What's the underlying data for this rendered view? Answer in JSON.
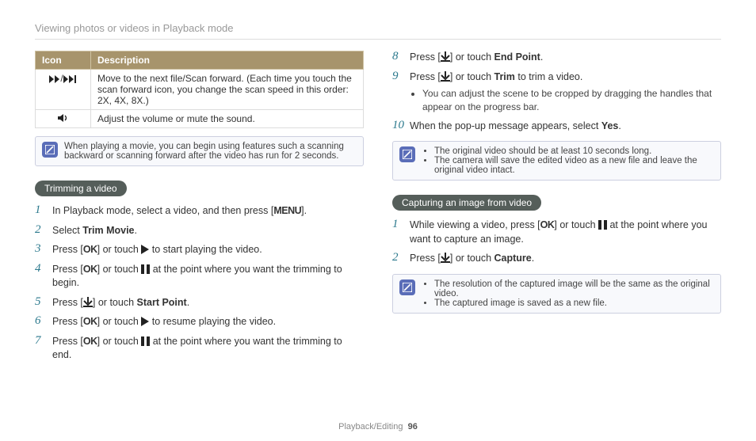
{
  "breadcrumb": "Viewing photos or videos in Playback mode",
  "table": {
    "header_icon": "Icon",
    "header_desc": "Description",
    "row1_desc": "Move to the next file/Scan forward. (Each time you touch the scan forward icon, you change the scan speed in this order: 2X, 4X, 8X.)",
    "row2_desc": "Adjust the volume or mute the sound."
  },
  "note_play": "When playing a movie, you can begin using features such a scanning backward or scanning forward after the video has run for 2 seconds.",
  "section_trim": "Trimming a video",
  "trim": {
    "s1a": "In Playback mode, select a video, and then press [",
    "s1_menu": "MENU",
    "s1b": "].",
    "s2a": "Select ",
    "s2_bold": "Trim Movie",
    "s2b": ".",
    "s3a": "Press [",
    "s3_ok": "OK",
    "s3b": "] or touch ",
    "s3c": " to start playing the video.",
    "s4a": "Press [",
    "s4_ok": "OK",
    "s4b": "] or touch ",
    "s4c": " at the point where you want the trimming to begin.",
    "s5a": "Press [",
    "s5b": "] or touch ",
    "s5_bold": "Start Point",
    "s5c": ".",
    "s6a": "Press [",
    "s6_ok": "OK",
    "s6b": "] or touch ",
    "s6c": " to resume playing the video.",
    "s7a": "Press [",
    "s7_ok": "OK",
    "s7b": "] or touch ",
    "s7c": " at the point where you want the trimming to end.",
    "s8a": "Press [",
    "s8b": "] or touch ",
    "s8_bold": "End Point",
    "s8c": ".",
    "s9a": "Press [",
    "s9b": "] or touch ",
    "s9_bold": "Trim",
    "s9c": " to trim a video.",
    "s9_sub": "You can adjust the scene to be cropped by dragging the handles that appear on the progress bar.",
    "s10a": "When the pop-up message appears, select ",
    "s10_bold": "Yes",
    "s10b": "."
  },
  "note_trim": {
    "l1": "The original video should be at least 10 seconds long.",
    "l2": "The camera will save the edited video as a new file and leave the original video intact."
  },
  "section_capture": "Capturing an image from video",
  "capture": {
    "s1a": "While viewing a video, press [",
    "s1_ok": "OK",
    "s1b": "] or touch ",
    "s1c": " at the point where you want to capture an image.",
    "s2a": "Press [",
    "s2b": "] or touch ",
    "s2_bold": "Capture",
    "s2c": "."
  },
  "note_capture": {
    "l1": "The resolution of the captured image will be the same as the original video.",
    "l2": "The captured image is saved as a new file."
  },
  "footer_section": "Playback/Editing",
  "footer_page": "96"
}
